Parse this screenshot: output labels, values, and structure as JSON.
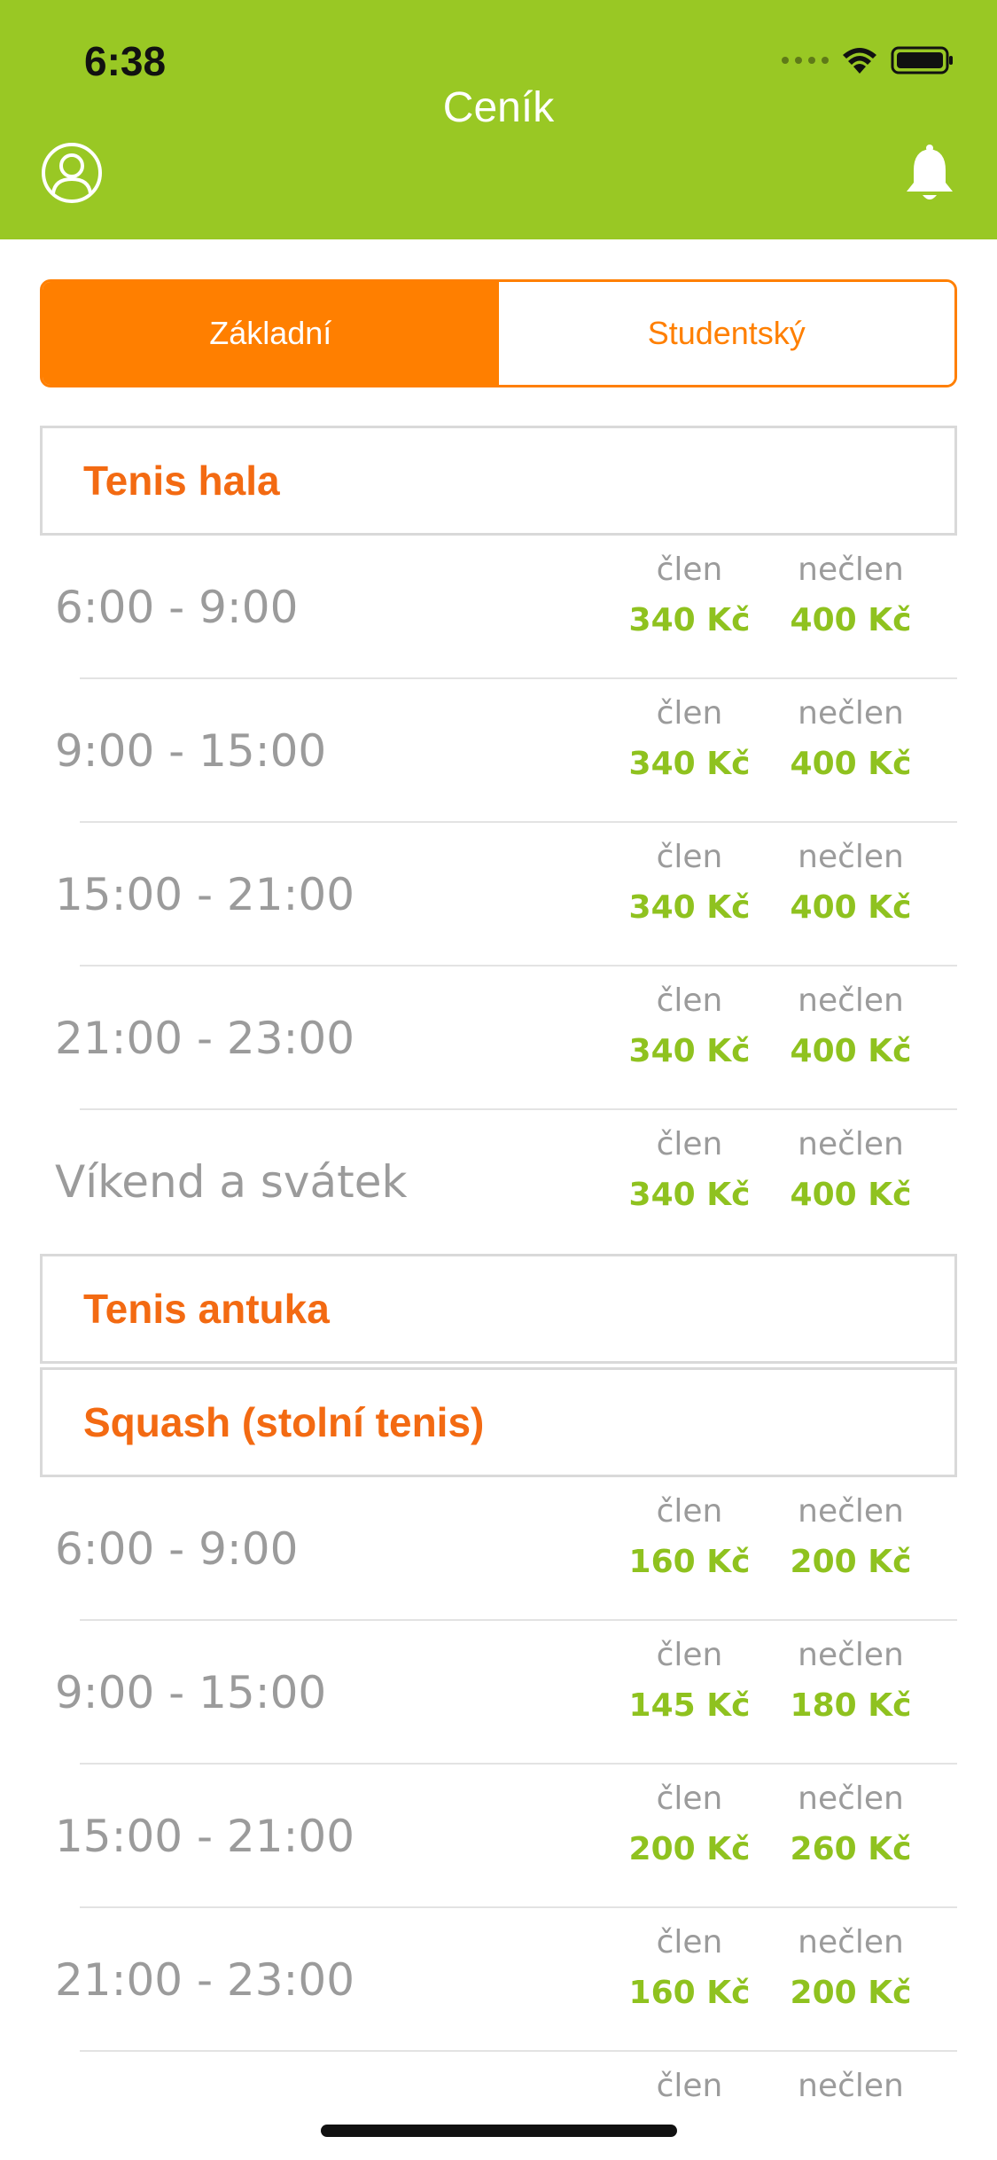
{
  "status_bar": {
    "time": "6:38"
  },
  "nav": {
    "title": "Ceník"
  },
  "tabs": [
    {
      "label": "Základní",
      "active": true
    },
    {
      "label": "Studentský",
      "active": false
    }
  ],
  "sections": [
    {
      "title": "Tenis hala",
      "rows": [
        {
          "time": "6:00 - 9:00",
          "member_label": "člen",
          "member_price": "340 Kč",
          "nonmember_label": "nečlen",
          "nonmember_price": "400 Kč"
        },
        {
          "time": "9:00 - 15:00",
          "member_label": "člen",
          "member_price": "340 Kč",
          "nonmember_label": "nečlen",
          "nonmember_price": "400 Kč"
        },
        {
          "time": "15:00 - 21:00",
          "member_label": "člen",
          "member_price": "340 Kč",
          "nonmember_label": "nečlen",
          "nonmember_price": "400 Kč"
        },
        {
          "time": "21:00 - 23:00",
          "member_label": "člen",
          "member_price": "340 Kč",
          "nonmember_label": "nečlen",
          "nonmember_price": "400 Kč"
        },
        {
          "time": "Víkend a svátek",
          "member_label": "člen",
          "member_price": "340 Kč",
          "nonmember_label": "nečlen",
          "nonmember_price": "400 Kč"
        }
      ]
    },
    {
      "title": "Tenis antuka",
      "rows": []
    },
    {
      "title": "Squash (stolní tenis)",
      "rows": [
        {
          "time": "6:00 - 9:00",
          "member_label": "člen",
          "member_price": "160 Kč",
          "nonmember_label": "nečlen",
          "nonmember_price": "200 Kč"
        },
        {
          "time": "9:00 - 15:00",
          "member_label": "člen",
          "member_price": "145 Kč",
          "nonmember_label": "nečlen",
          "nonmember_price": "180 Kč"
        },
        {
          "time": "15:00 - 21:00",
          "member_label": "člen",
          "member_price": "200 Kč",
          "nonmember_label": "nečlen",
          "nonmember_price": "260 Kč"
        },
        {
          "time": "21:00 - 23:00",
          "member_label": "člen",
          "member_price": "160 Kč",
          "nonmember_label": "nečlen",
          "nonmember_price": "200 Kč"
        },
        {
          "time": "",
          "member_label": "člen",
          "member_price": "",
          "nonmember_label": "nečlen",
          "nonmember_price": ""
        }
      ]
    }
  ],
  "colors": {
    "header_green": "#99c824",
    "accent_orange": "#ff7f00",
    "section_title": "#f36a12",
    "price_green": "#8fc21f",
    "muted_gray": "#9b9b9b"
  },
  "icons": {
    "profile": "user-circle-icon",
    "notifications": "bell-icon",
    "signal": "cellular-signal-icon",
    "wifi": "wifi-icon",
    "battery": "battery-icon"
  }
}
